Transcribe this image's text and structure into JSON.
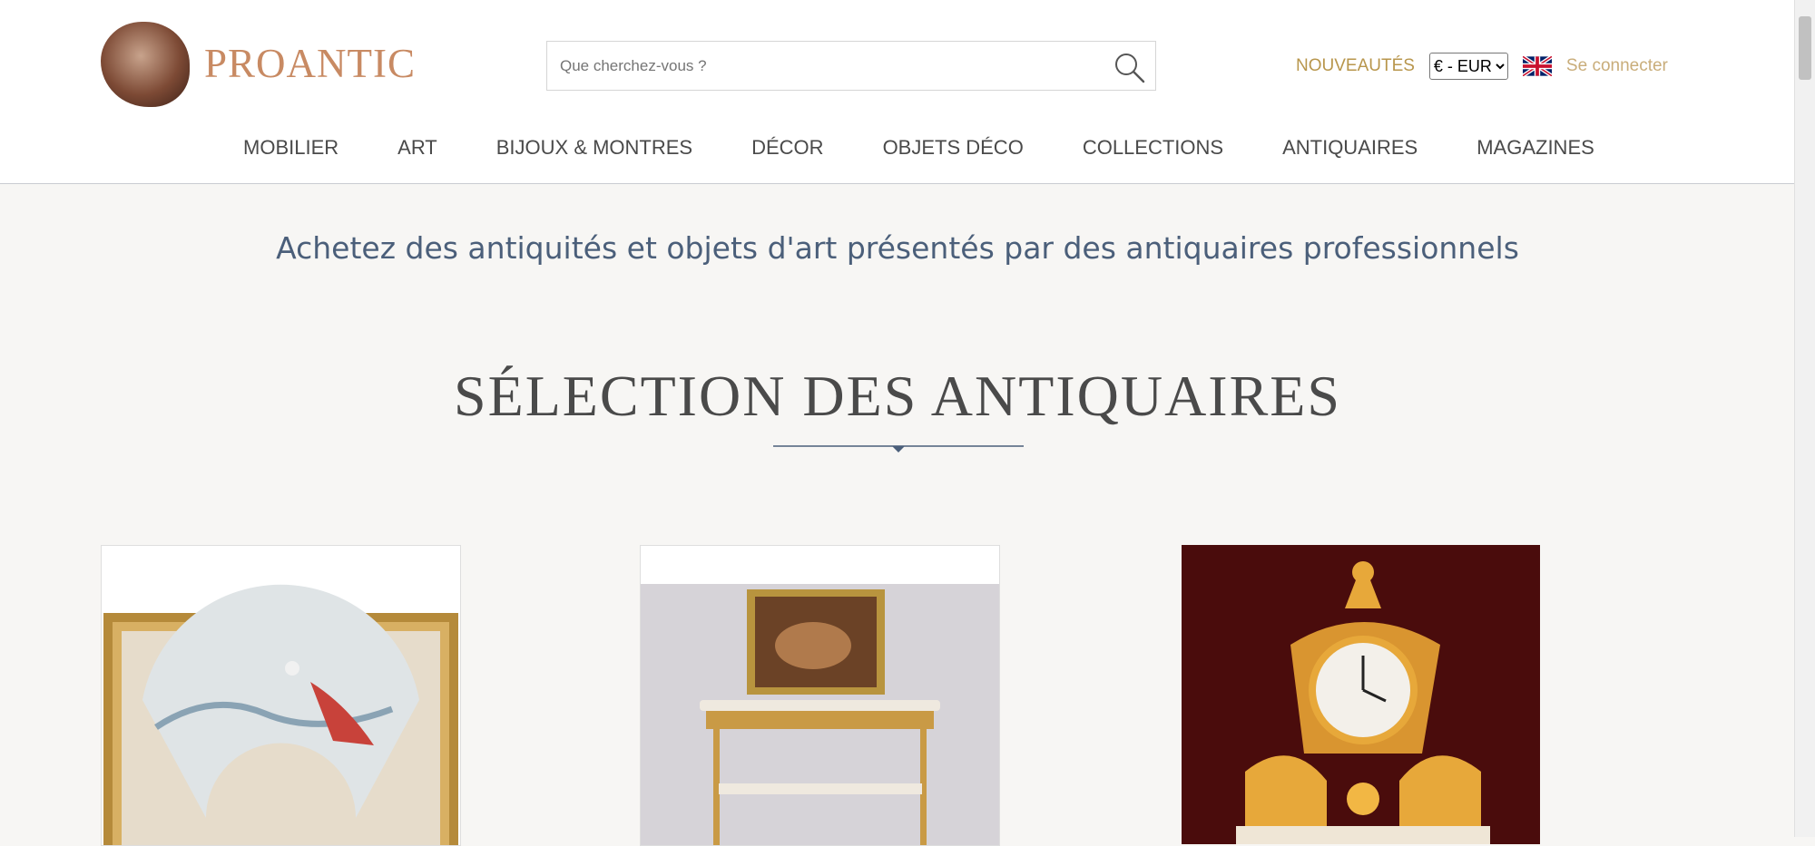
{
  "header": {
    "logo_text": "PROANTIC",
    "search": {
      "placeholder": "Que cherchez-vous ?",
      "value": ""
    },
    "new_label": "NOUVEAUTÉS",
    "currency_selected": "€ - EUR",
    "login_label": "Se connecter"
  },
  "nav": {
    "items": [
      {
        "label": "MOBILIER"
      },
      {
        "label": "ART"
      },
      {
        "label": "BIJOUX & MONTRES"
      },
      {
        "label": "DÉCOR"
      },
      {
        "label": "OBJETS DÉCO"
      },
      {
        "label": "COLLECTIONS"
      },
      {
        "label": "ANTIQUAIRES"
      },
      {
        "label": "MAGAZINES"
      }
    ]
  },
  "tagline": "Achetez des antiquités et objets d'art présentés par des antiquaires professionnels",
  "section": {
    "title": "SÉLECTION DES ANTIQUAIRES"
  },
  "colors": {
    "brand": "#c88a63",
    "gold": "#b8964c",
    "tagline": "#4b5f7a",
    "background": "#f7f6f4"
  }
}
